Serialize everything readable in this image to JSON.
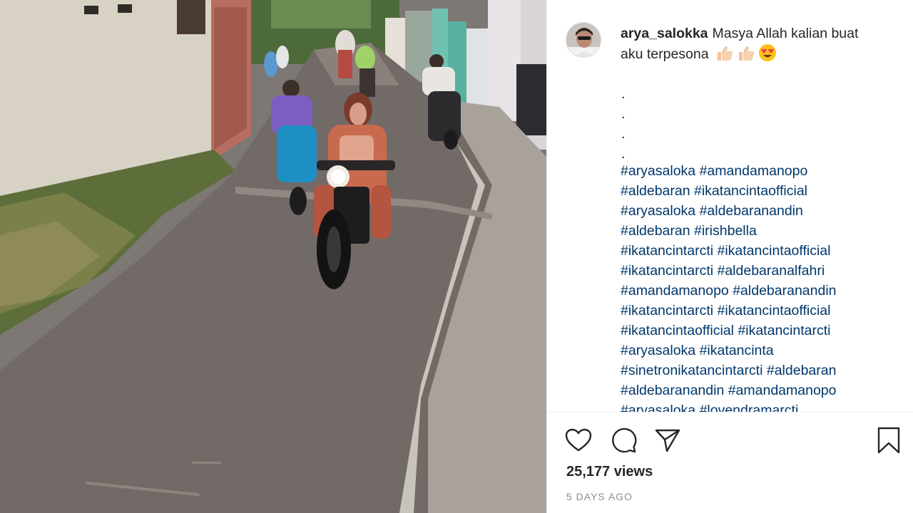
{
  "post": {
    "username": "arya_salokka",
    "caption": "Masya Allah kalian buat aku terpesona",
    "caption_emojis": [
      "thumbs-up-icon",
      "thumbs-up-icon",
      "heart-eyes-icon"
    ],
    "dots": [
      ".",
      ".",
      ".",
      "."
    ],
    "hashtag_lines": [
      "#aryasaloka #amandamanopo",
      "#aldebaran #ikatancintaofficial",
      "#aryasaloka #aldebaranandin",
      "#aldebaran #irishbella",
      "#ikatancintarcti #ikatancintaofficial",
      "#ikatancintarcti #aldebaranalfahri",
      "#amandamanopo #aldebaranandin",
      "#ikatancintarcti #ikatancintaofficial",
      "#ikatancintaofficial #ikatancintarcti",
      "#aryasaloka #ikatancinta",
      "#sinetronikatancintarcti #aldebaran",
      "#aldebaranandin #amandamanopo",
      "#aryasaloka #lovendramarcti"
    ],
    "views": "25,177 views",
    "time_ago": "5 DAYS AGO"
  },
  "icons": {
    "like": "heart-icon",
    "comment": "comment-icon",
    "share": "share-icon",
    "save": "bookmark-icon"
  },
  "colors": {
    "hashtag": "#00376b",
    "text": "#262626",
    "muted": "#8e8e8e"
  }
}
